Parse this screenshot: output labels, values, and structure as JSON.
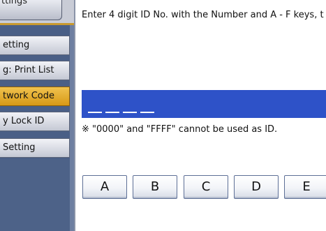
{
  "sidebar": {
    "header_tab": "ttings",
    "items": [
      {
        "label": "etting",
        "active": false
      },
      {
        "label": "g: Print List",
        "active": false
      },
      {
        "label": "twork Code",
        "active": true
      },
      {
        "label": "y Lock ID",
        "active": false
      },
      {
        "label": "Setting",
        "active": false
      }
    ]
  },
  "main": {
    "instruction": "Enter 4 digit ID No. with the Number and A - F keys, t",
    "id_value": "",
    "note": "※ \"0000\" and \"FFFF\" cannot be used as ID.",
    "keys": [
      "A",
      "B",
      "C",
      "D",
      "E"
    ]
  },
  "colors": {
    "accent": "#2e52c8",
    "active_item": "#e3a82a",
    "sidebar_bg": "#4a5f86"
  }
}
